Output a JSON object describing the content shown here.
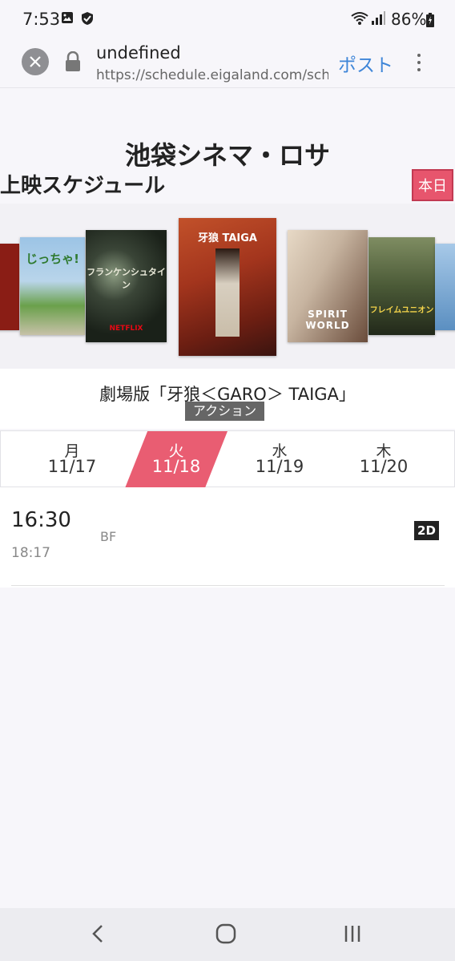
{
  "status": {
    "time": "7:53",
    "battery": "86%",
    "icons": [
      "image-icon",
      "shield-icon",
      "wifi-icon",
      "signal-icon",
      "battery-charging-icon"
    ]
  },
  "browser": {
    "title": "undefined",
    "url": "https://schedule.eigaland.com/sche",
    "post_label": "ポスト"
  },
  "page": {
    "theater_name": "池袋シネマ・ロサ",
    "schedule_title": "上映スケジュール",
    "today_label": "本日"
  },
  "posters": [
    {
      "caption": "",
      "color": "#8a1d15"
    },
    {
      "caption": "じっちゃ!",
      "color": "#6f9ec9"
    },
    {
      "caption": "フランケンシュタイン",
      "color": "#253022"
    },
    {
      "caption": "牙狼 TAIGA",
      "color": "#a3351d"
    },
    {
      "caption": "SPIRIT WORLD",
      "color": "#c7b4a0"
    },
    {
      "caption": "フレイムユニオン",
      "color": "#4b5a37"
    },
    {
      "caption": "",
      "color": "#5b8fc1"
    }
  ],
  "movie": {
    "title": "劇場版「牙狼＜GARO＞ TAIGA」",
    "genre": "アクション"
  },
  "dates": [
    {
      "dow": "月",
      "md": "11/17",
      "selected": false
    },
    {
      "dow": "火",
      "md": "11/18",
      "selected": true
    },
    {
      "dow": "水",
      "md": "11/19",
      "selected": false
    },
    {
      "dow": "木",
      "md": "11/20",
      "selected": false
    }
  ],
  "showtime": {
    "start": "16:30",
    "end": "18:17",
    "screen": "BF",
    "format": "2D"
  },
  "colors": {
    "accent": "#e95d72",
    "link": "#3f86d8"
  }
}
